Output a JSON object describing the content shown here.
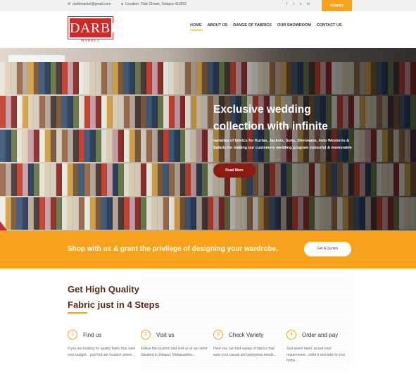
{
  "topbar": {
    "email": "darbimarket@gmail.com",
    "location": "Location: Tilak Chowk, Solapur-413002",
    "socials": [
      "f",
      "t",
      "s",
      "in"
    ],
    "enquiry_label": "Enquiry"
  },
  "brand": {
    "logo_text": "DARBI",
    "logo_sub": "MARKET",
    "color": "#c92a2a"
  },
  "nav": {
    "items": [
      "HOME",
      "ABOUT US",
      "RANGE OF FABRICS",
      "OUR SHOWROOM",
      "CONTACT US"
    ],
    "active": "HOME"
  },
  "hero": {
    "title": "Exclusive wedding collection with infinite",
    "description": "varieties of fabrics for Kurtas, Jackets, Suits, Sherwanis, Indo Westerns & Safaris for making our customers wedding program colourful & memorable",
    "button_label": "Read More"
  },
  "band": {
    "text": "Shop with us & grant the privilege of designing your wardrobe.",
    "button_label": "Get A Quotes",
    "accent": "#f7a21c"
  },
  "steps": {
    "title_line1": "Get High Quality",
    "title_line2": "Fabric just in 4 Steps",
    "items": [
      {
        "num": "1",
        "name": "Find us",
        "desc": "If you are looking for quality fabric that suits your budget... just find our location online..."
      },
      {
        "num": "2",
        "name": "Visit us",
        "desc": "Follow the location and visit us at our store Situated in Solapur, Maharashtra..."
      },
      {
        "num": "3",
        "name": "Check Variety",
        "desc": "Here you can find variety of fabrics that suits your casual and partywear needs..."
      },
      {
        "num": "4",
        "name": "Order and pay",
        "desc": "Just select fabric as per your requirement...order it and take to your home..."
      }
    ]
  }
}
